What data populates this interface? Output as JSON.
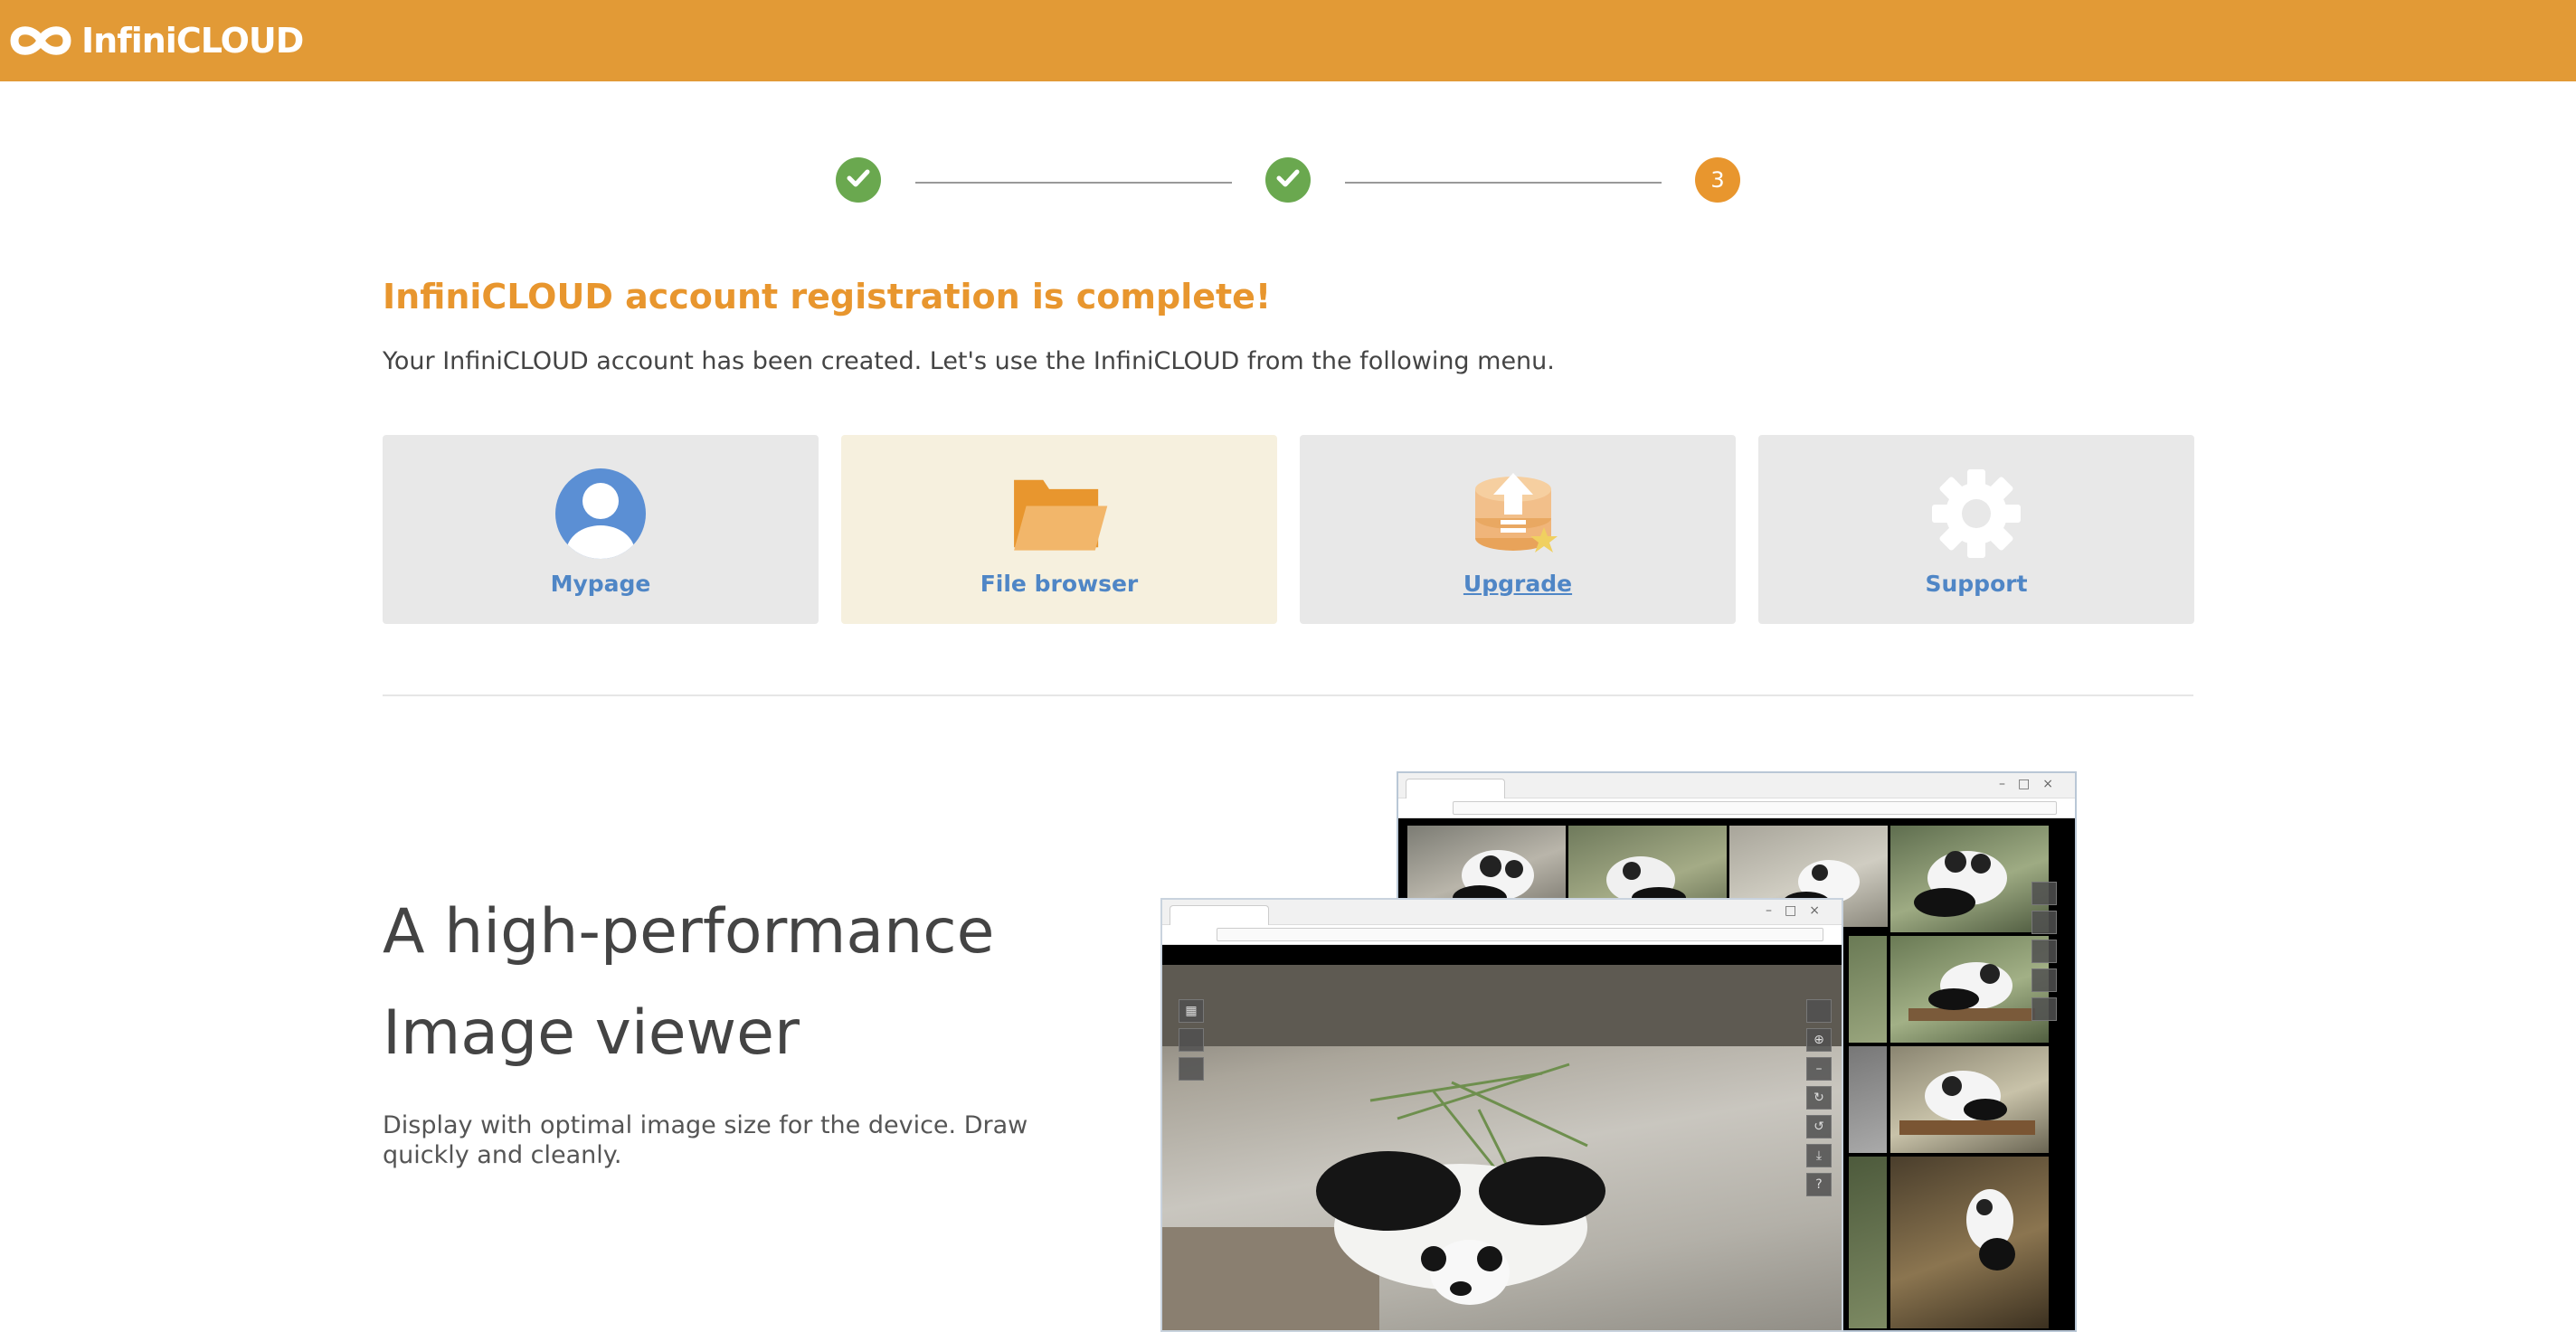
{
  "header": {
    "brand": "InfiniCLOUD",
    "brand_color": "#e29a36",
    "logo_icon": "infinity-cloud-icon"
  },
  "stepper": {
    "steps": [
      {
        "state": "done",
        "icon": "check-icon"
      },
      {
        "state": "done",
        "icon": "check-icon"
      },
      {
        "state": "current",
        "label": "3"
      }
    ],
    "done_color": "#6aa84f",
    "current_color": "#e8962e"
  },
  "main": {
    "title": "InfiniCLOUD account registration is complete!",
    "intro": "Your InfiniCLOUD account has been created. Let's use the InfiniCLOUD from the following menu."
  },
  "menu": {
    "items": [
      {
        "label": "Mypage",
        "icon": "user-icon"
      },
      {
        "label": "File browser",
        "icon": "folder-icon"
      },
      {
        "label": "Upgrade",
        "icon": "upgrade-icon"
      },
      {
        "label": "Support",
        "icon": "gear-icon"
      }
    ],
    "label_color": "#4f86c6"
  },
  "feature": {
    "title_line1": "A high-performance",
    "title_line2": "Image viewer",
    "description": "Display with optimal image size for the device. Draw quickly and cleanly."
  }
}
